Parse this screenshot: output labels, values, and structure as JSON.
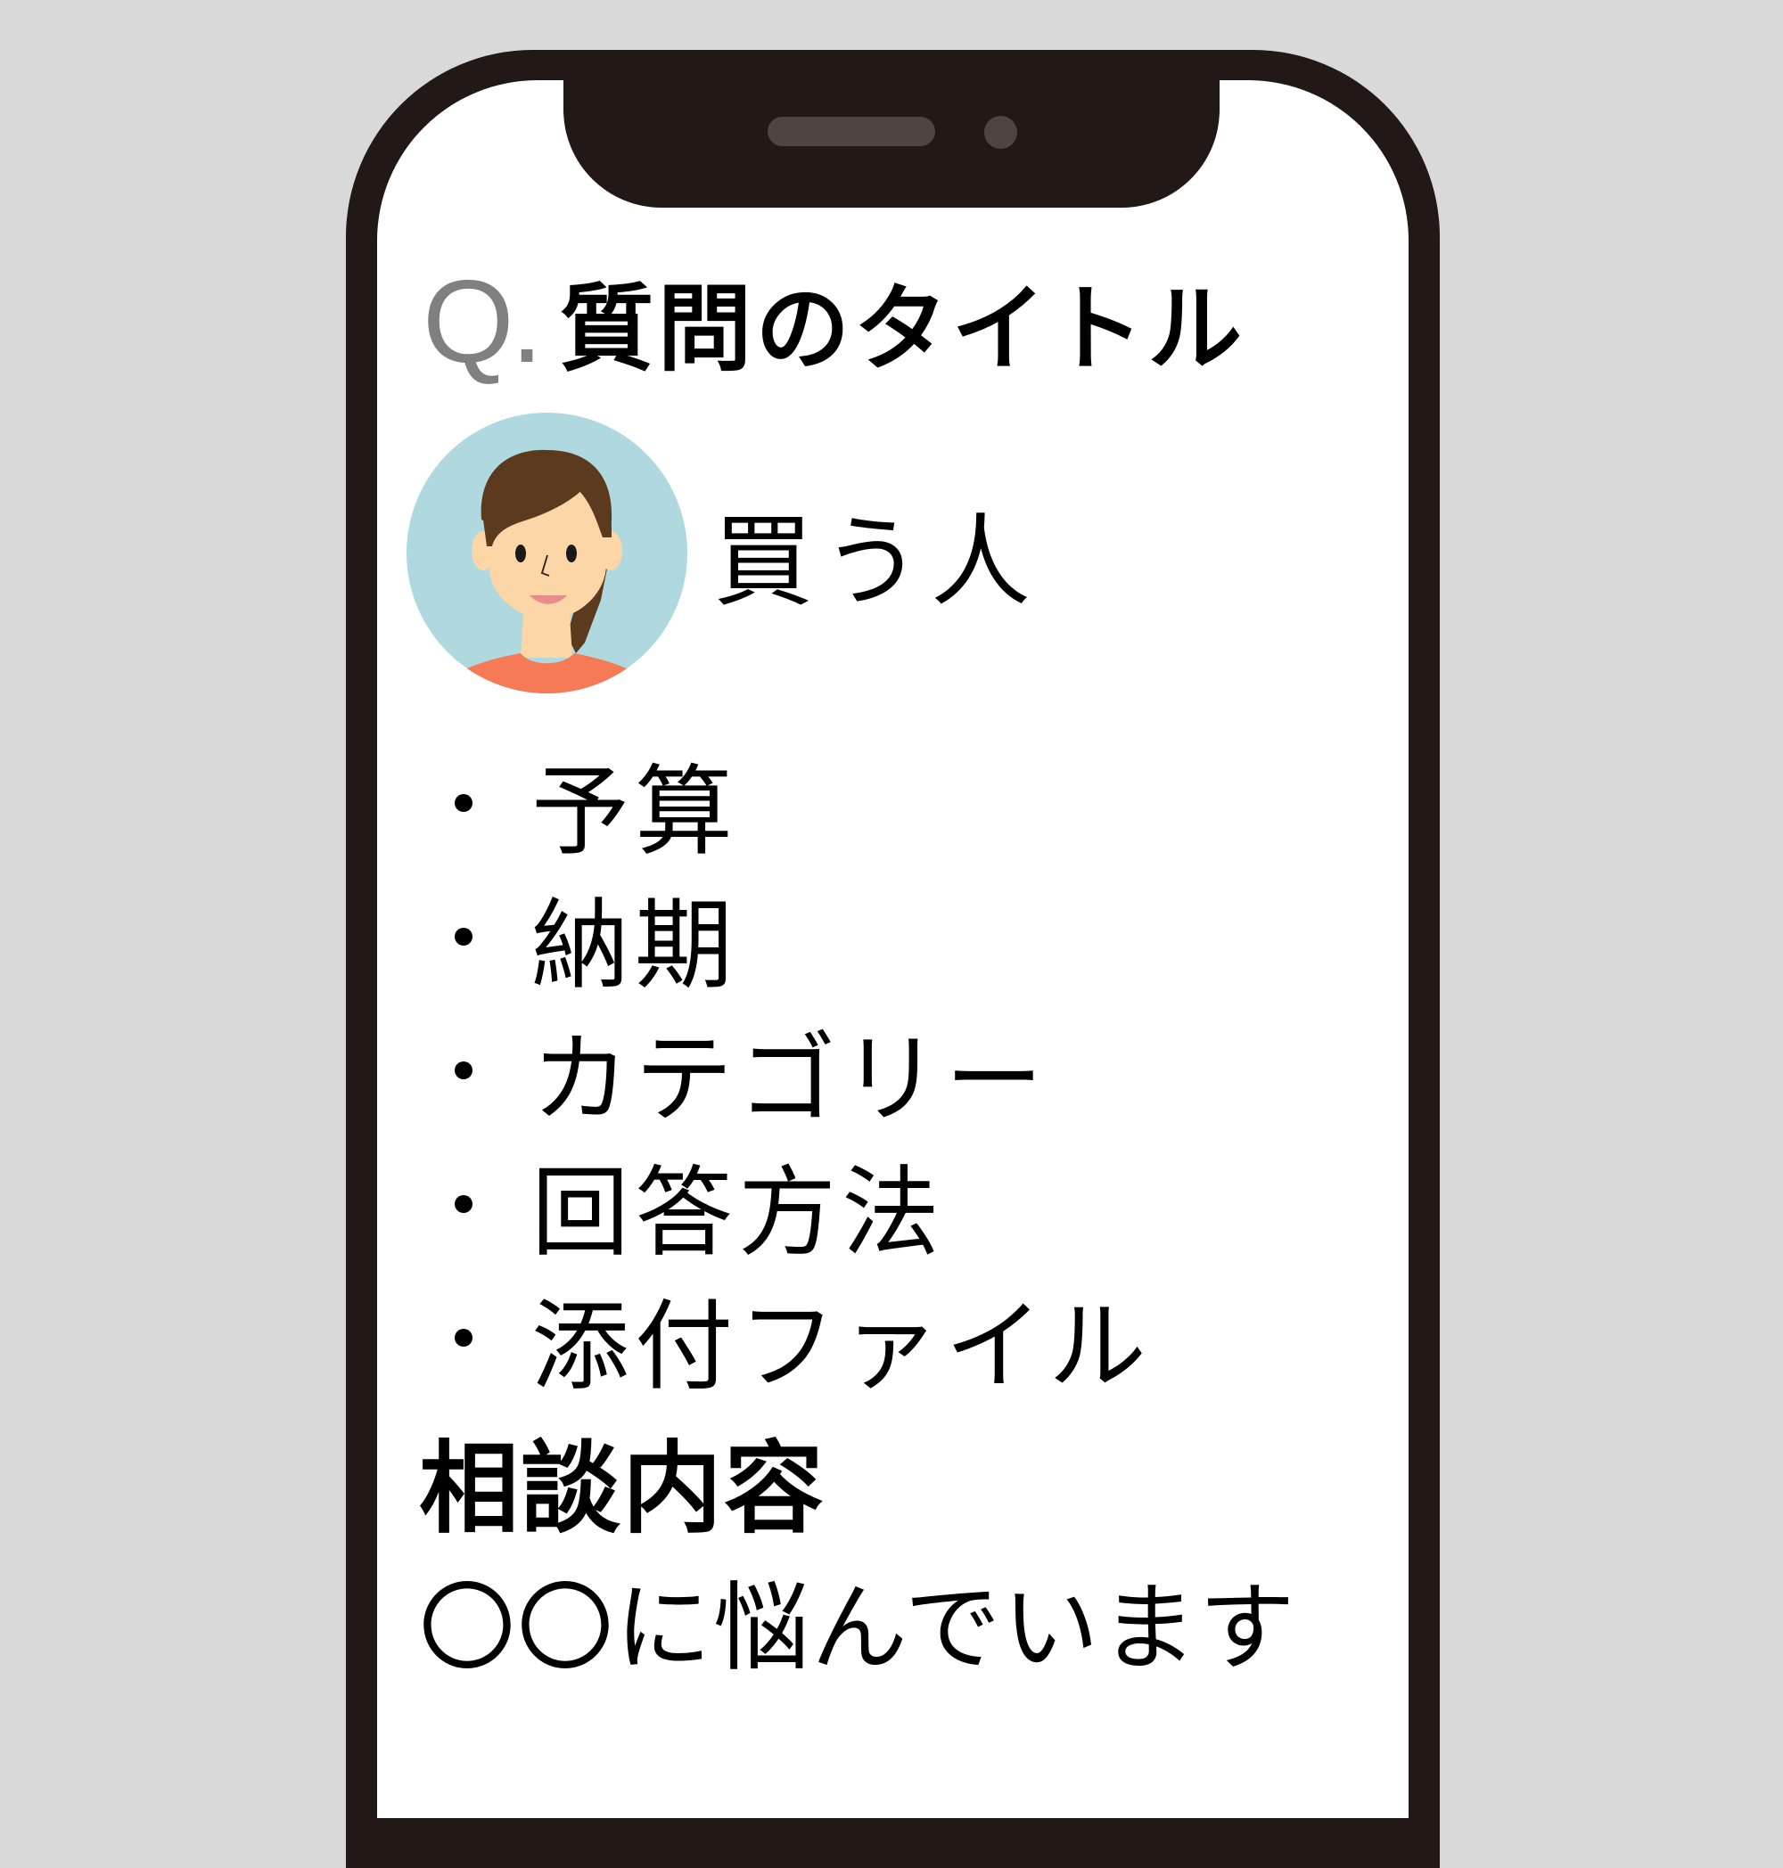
{
  "question": {
    "prefix": "Q.",
    "title": "質問のタイトル"
  },
  "user": {
    "name": "買う人",
    "avatar_icon": "woman-avatar-icon"
  },
  "items": [
    {
      "label": "予算"
    },
    {
      "label": "納期"
    },
    {
      "label": "カテゴリー"
    },
    {
      "label": "回答方法"
    },
    {
      "label": "添付ファイル"
    }
  ],
  "consultation": {
    "heading": "相談内容",
    "body": "〇〇に悩んでいます"
  },
  "colors": {
    "background": "#d9d9d9",
    "phone_frame": "#221815",
    "screen": "#ffffff",
    "question_prefix": "#808080",
    "avatar_bg": "#afd9de",
    "avatar_shirt": "#f57a55",
    "avatar_hair": "#5b3a1e",
    "avatar_skin": "#fdd6a8"
  }
}
